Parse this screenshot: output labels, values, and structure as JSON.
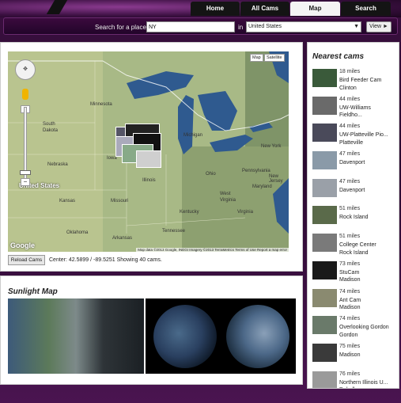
{
  "nav": {
    "tabs": [
      {
        "label": "Home"
      },
      {
        "label": "All Cams"
      },
      {
        "label": "Map",
        "active": true
      },
      {
        "label": "Search"
      }
    ]
  },
  "search": {
    "label": "Search for a place:",
    "value": "NY",
    "in_label": "in",
    "country": "United States",
    "view_label": "View ►"
  },
  "map": {
    "type_buttons": [
      "Map",
      "Satellite"
    ],
    "labels": {
      "minnesota": "Minnesota",
      "south_dakota": "South\nDakota",
      "nebraska": "Nebraska",
      "kansas": "Kansas",
      "oklahoma": "Oklahoma",
      "missouri": "Missouri",
      "arkansas": "Arkansas",
      "iowa": "Iowa",
      "illinois": "Illinois",
      "michigan": "Michigan",
      "ohio": "Ohio",
      "kentucky": "Kentucky",
      "tennessee": "Tennessee",
      "virginia": "Virginia",
      "west_virginia": "West\nVirginia",
      "pennsylvania": "Pennsylvania",
      "new_york": "New York",
      "maryland": "Maryland",
      "new_jersey": "New Jersey",
      "united_states": "United States"
    },
    "google_logo": "Google",
    "attribution": "Map data ©2013 Google, INEGI Imagery ©2013 TerraMetrics   Terms of Use   Report a map error",
    "reload_label": "Reload Cams",
    "center_text": "Center: 42.5899 / -89.5251 Showing 40 cams."
  },
  "sunlight": {
    "title": "Sunlight Map"
  },
  "nearest": {
    "title": "Nearest cams",
    "cams": [
      {
        "dist": "18 miles",
        "name": "Bird Feeder Cam\nClinton",
        "color": "#3a5a3a"
      },
      {
        "dist": "44 miles",
        "name": "UW-Williams\nFieldho...",
        "color": "#6a6a6a"
      },
      {
        "dist": "44 miles",
        "name": "UW-Platteville Pio...\nPlatteville",
        "color": "#4a4a5a"
      },
      {
        "dist": "47 miles",
        "name": "Davenport",
        "color": "#8a9aa8"
      },
      {
        "dist": "47 miles",
        "name": "Davenport",
        "color": "#9aa0a8"
      },
      {
        "dist": "51 miles",
        "name": "Rock Island",
        "color": "#5a6a4a"
      },
      {
        "dist": "51 miles",
        "name": "College Center\nRock Island",
        "color": "#7a7a7a"
      },
      {
        "dist": "73 miles",
        "name": "StuCam\nMadison",
        "color": "#1a1a1a"
      },
      {
        "dist": "74 miles",
        "name": "Ant Cam\nMadison",
        "color": "#8a8a70"
      },
      {
        "dist": "74 miles",
        "name": "Overlooking Gordon\nGordon",
        "color": "#6a7a6a"
      },
      {
        "dist": "75 miles",
        "name": "Madison",
        "color": "#3a3a3a"
      },
      {
        "dist": "76 miles",
        "name": "Northern Illinois U...\nDekalb",
        "color": "#9a9a9a"
      }
    ]
  }
}
